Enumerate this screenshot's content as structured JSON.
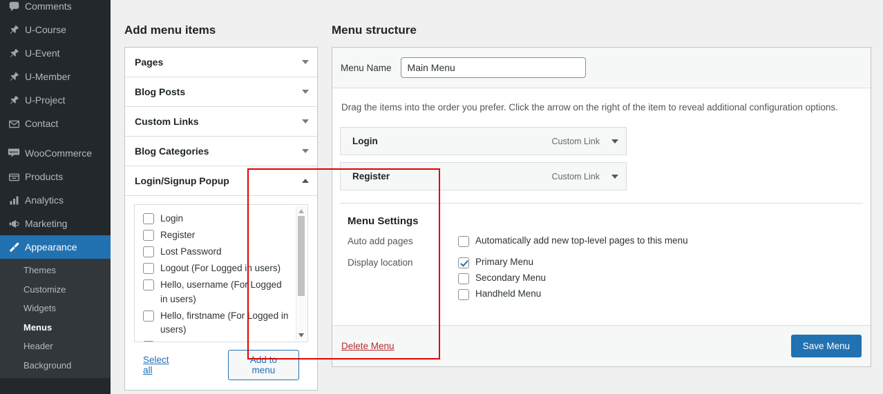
{
  "sidebar": {
    "items": [
      {
        "label": "Comments",
        "icon": "comment-icon",
        "active": false
      },
      {
        "label": "U-Course",
        "icon": "pin-icon",
        "active": false
      },
      {
        "label": "U-Event",
        "icon": "pin-icon",
        "active": false
      },
      {
        "label": "U-Member",
        "icon": "pin-icon",
        "active": false
      },
      {
        "label": "U-Project",
        "icon": "pin-icon",
        "active": false
      },
      {
        "label": "Contact",
        "icon": "envelope-icon",
        "active": false
      },
      {
        "label": "WooCommerce",
        "icon": "woo-icon",
        "active": false
      },
      {
        "label": "Products",
        "icon": "products-icon",
        "active": false
      },
      {
        "label": "Analytics",
        "icon": "chart-bar-icon",
        "active": false
      },
      {
        "label": "Marketing",
        "icon": "megaphone-icon",
        "active": false
      },
      {
        "label": "Appearance",
        "icon": "paintbrush-icon",
        "active": true
      }
    ],
    "submenu": [
      {
        "label": "Themes",
        "current": false
      },
      {
        "label": "Customize",
        "current": false
      },
      {
        "label": "Widgets",
        "current": false
      },
      {
        "label": "Menus",
        "current": true
      },
      {
        "label": "Header",
        "current": false
      },
      {
        "label": "Background",
        "current": false
      }
    ],
    "active_color": "#2271b1",
    "background_color": "#23282d",
    "submenu_background_color": "#32373c"
  },
  "add_menu_items": {
    "title": "Add menu items",
    "panels": [
      {
        "label": "Pages",
        "expanded": false,
        "arrow": "chevron-down-icon"
      },
      {
        "label": "Blog Posts",
        "expanded": false,
        "arrow": "chevron-down-icon"
      },
      {
        "label": "Custom Links",
        "expanded": false,
        "arrow": "chevron-down-icon"
      },
      {
        "label": "Blog Categories",
        "expanded": false,
        "arrow": "chevron-down-icon"
      },
      {
        "label": "Login/Signup Popup",
        "expanded": true,
        "arrow": "chevron-up-icon"
      }
    ],
    "checklist": [
      {
        "label": "Login",
        "checked": false
      },
      {
        "label": "Register",
        "checked": false
      },
      {
        "label": "Lost Password",
        "checked": false
      },
      {
        "label": "Logout (For Logged in users)",
        "checked": false
      },
      {
        "label": "Hello, username (For Logged in users)",
        "checked": false
      },
      {
        "label": "Hello, firstname (For Logged in users)",
        "checked": false
      }
    ],
    "select_all_label": "Select all",
    "add_to_menu_label": "Add to menu",
    "highlight_color": "#e00000"
  },
  "menu_structure": {
    "title": "Menu structure",
    "menu_name_label": "Menu Name",
    "menu_name_value": "Main Menu",
    "menu_name_placeholder": "Enter menu name here",
    "help_text": "Drag the items into the order you prefer. Click the arrow on the right of the item to reveal additional configuration options.",
    "items": [
      {
        "title": "Login",
        "type": "Custom Link"
      },
      {
        "title": "Register",
        "type": "Custom Link"
      }
    ],
    "settings": {
      "title": "Menu Settings",
      "auto_add_label": "Auto add pages",
      "auto_add_option": "Automatically add new top-level pages to this menu",
      "auto_add_checked": false,
      "display_location_label": "Display location",
      "locations": [
        {
          "label": "Primary Menu",
          "checked": true
        },
        {
          "label": "Secondary Menu",
          "checked": false
        },
        {
          "label": "Handheld Menu",
          "checked": false
        }
      ]
    },
    "delete_label": "Delete Menu",
    "save_label": "Save Menu",
    "save_color": "#2271b1",
    "delete_color": "#b32d2e"
  }
}
